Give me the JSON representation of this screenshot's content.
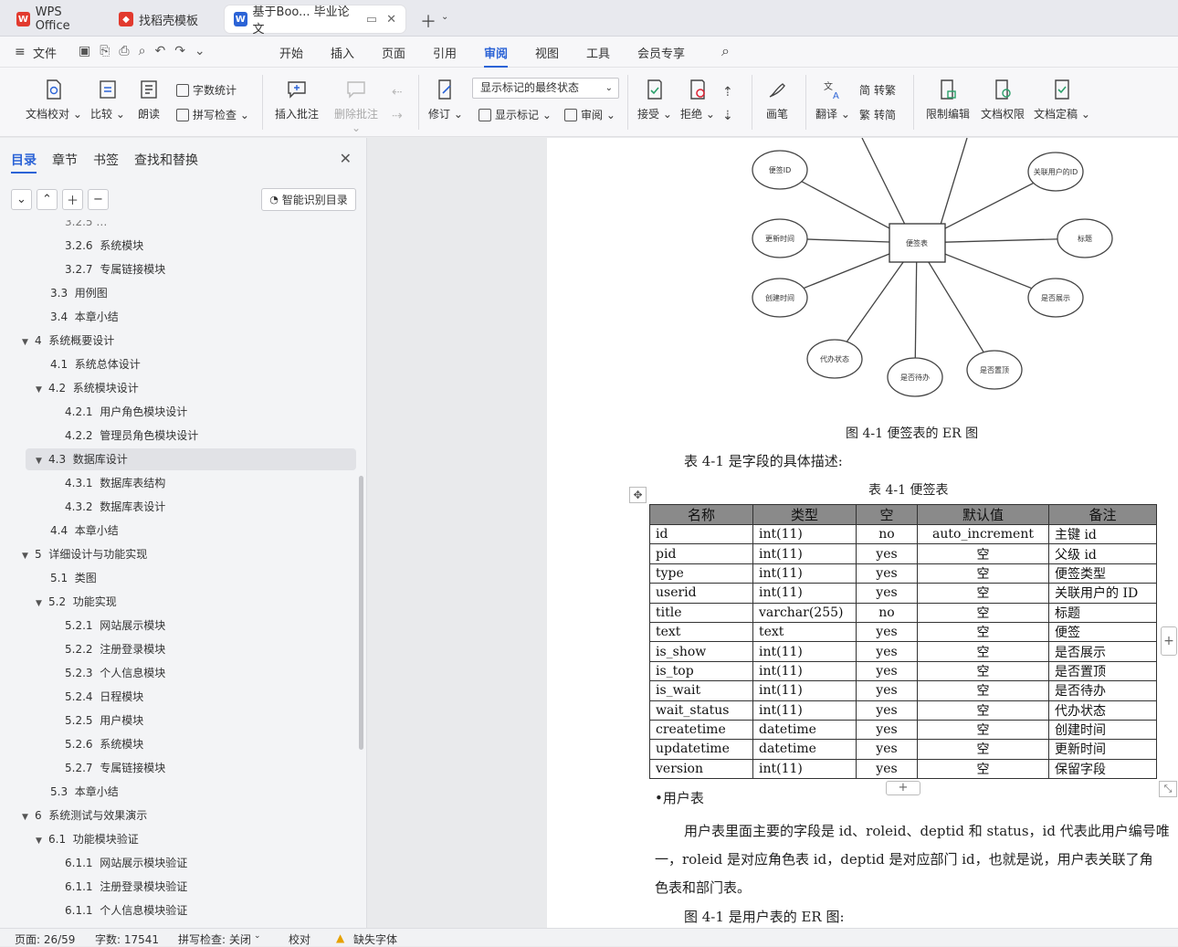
{
  "tabs": [
    {
      "label": "WPS Office"
    },
    {
      "label": "找稻壳模板"
    },
    {
      "label": "基于Boo... 毕业论文"
    }
  ],
  "menu": {
    "file": "文件",
    "items": [
      "开始",
      "插入",
      "页面",
      "引用",
      "审阅",
      "视图",
      "工具",
      "会员专享"
    ]
  },
  "ribbon": {
    "proofread": "文档校对",
    "compare": "比较",
    "read_aloud": "朗读",
    "word_count": "字数统计",
    "spell_check": "拼写检查",
    "insert_comment": "插入批注",
    "delete_comment": "删除批注",
    "revise": "修订",
    "display_state": "显示标记的最终状态",
    "show_markup": "显示标记",
    "review": "审阅",
    "accept": "接受",
    "reject": "拒绝",
    "pen": "画笔",
    "translate": "翻译",
    "to_traditional": "转繁",
    "to_simplified": "转简",
    "restrict_edit": "限制编辑",
    "doc_permission": "文档权限",
    "doc_finalize": "文档定稿"
  },
  "sidebar": {
    "tabs": [
      "目录",
      "章节",
      "书签",
      "查找和替换"
    ],
    "smart_button": "智能识别目录",
    "toc": [
      {
        "num": "3.2.6",
        "text": "系统模块",
        "level": 3
      },
      {
        "num": "3.2.7",
        "text": "专属链接模块",
        "level": 3
      },
      {
        "num": "3.3",
        "text": "用例图",
        "level": 2
      },
      {
        "num": "3.4",
        "text": "本章小结",
        "level": 2
      },
      {
        "num": "4",
        "text": "系统概要设计",
        "level": 1,
        "arrow": true
      },
      {
        "num": "4.1",
        "text": "系统总体设计",
        "level": 2
      },
      {
        "num": "4.2",
        "text": "系统模块设计",
        "level": 2,
        "arrow": true
      },
      {
        "num": "4.2.1",
        "text": "用户角色模块设计",
        "level": 3
      },
      {
        "num": "4.2.2",
        "text": "管理员角色模块设计",
        "level": 3
      },
      {
        "num": "4.3",
        "text": "数据库设计",
        "level": 2,
        "arrow": true,
        "selected": true
      },
      {
        "num": "4.3.1",
        "text": "数据库表结构",
        "level": 3
      },
      {
        "num": "4.3.2",
        "text": "数据库表设计",
        "level": 3
      },
      {
        "num": "4.4",
        "text": "本章小结",
        "level": 2
      },
      {
        "num": "5",
        "text": "详细设计与功能实现",
        "level": 1,
        "arrow": true
      },
      {
        "num": "5.1",
        "text": "类图",
        "level": 2
      },
      {
        "num": "5.2",
        "text": "功能实现",
        "level": 2,
        "arrow": true
      },
      {
        "num": "5.2.1",
        "text": "网站展示模块",
        "level": 3
      },
      {
        "num": "5.2.2",
        "text": "注册登录模块",
        "level": 3
      },
      {
        "num": "5.2.3",
        "text": "个人信息模块",
        "level": 3
      },
      {
        "num": "5.2.4",
        "text": "日程模块",
        "level": 3
      },
      {
        "num": "5.2.5",
        "text": "用户模块",
        "level": 3
      },
      {
        "num": "5.2.6",
        "text": "系统模块",
        "level": 3
      },
      {
        "num": "5.2.7",
        "text": "专属链接模块",
        "level": 3
      },
      {
        "num": "5.3",
        "text": "本章小结",
        "level": 2
      },
      {
        "num": "6",
        "text": "系统测试与效果演示",
        "level": 1,
        "arrow": true
      },
      {
        "num": "6.1",
        "text": "功能模块验证",
        "level": 2,
        "arrow": true
      },
      {
        "num": "6.1.1",
        "text": "网站展示模块验证",
        "level": 3
      },
      {
        "num": "6.1.1",
        "text": "注册登录模块验证",
        "level": 3
      },
      {
        "num": "6.1.1",
        "text": "个人信息模块验证",
        "level": 3
      }
    ]
  },
  "er": {
    "center": "便签表",
    "attributes": [
      "便签ID",
      "关联用户的ID",
      "更新时间",
      "标题",
      "创建时间",
      "是否展示",
      "代办状态",
      "是否待办",
      "是否置顶"
    ]
  },
  "document": {
    "figure_caption": "图 4-1  便签表的 ER 图",
    "table_intro": "表 4-1 是字段的具体描述:",
    "table_caption": "表 4-1  便签表",
    "table_headers": [
      "名称",
      "类型",
      "空",
      "默认值",
      "备注"
    ],
    "table_rows": [
      [
        "id",
        "int(11)",
        "no",
        "auto_increment",
        "主键 id"
      ],
      [
        "pid",
        "int(11)",
        "yes",
        "空",
        "父级 id"
      ],
      [
        "type",
        "int(11)",
        "yes",
        "空",
        "便签类型"
      ],
      [
        "userid",
        "int(11)",
        "yes",
        "空",
        "关联用户的 ID"
      ],
      [
        "title",
        "varchar(255)",
        "no",
        "空",
        "标题"
      ],
      [
        "text",
        "text",
        "yes",
        "空",
        "便签"
      ],
      [
        "is_show",
        "int(11)",
        "yes",
        "空",
        "是否展示"
      ],
      [
        "is_top",
        "int(11)",
        "yes",
        "空",
        "是否置顶"
      ],
      [
        "is_wait",
        "int(11)",
        "yes",
        "空",
        "是否待办"
      ],
      [
        "wait_status",
        "int(11)",
        "yes",
        "空",
        "代办状态"
      ],
      [
        "createtime",
        "datetime",
        "yes",
        "空",
        "创建时间"
      ],
      [
        "updatetime",
        "datetime",
        "yes",
        "空",
        "更新时间"
      ],
      [
        "version",
        "int(11)",
        "yes",
        "空",
        "保留字段"
      ]
    ],
    "user_table_heading": "•用户表",
    "para1_line1": "用户表里面主要的字段是 id、roleid、deptid 和 status，id 代表此用户编号唯",
    "para1_line2": "一，roleid 是对应角色表 id，deptid 是对应部门 id，也就是说，用户表关联了角",
    "para1_line3": "色表和部门表。",
    "para2": "图 4-1 是用户表的 ER 图:"
  },
  "status": {
    "page": "页面: 26/59",
    "words": "字数: 17541",
    "spell": "拼写检查: 关闭",
    "proof": "校对",
    "missing_font": "缺失字体"
  },
  "colors": {
    "accent": "#2b63d6",
    "wps_red": "#e23a2e"
  }
}
